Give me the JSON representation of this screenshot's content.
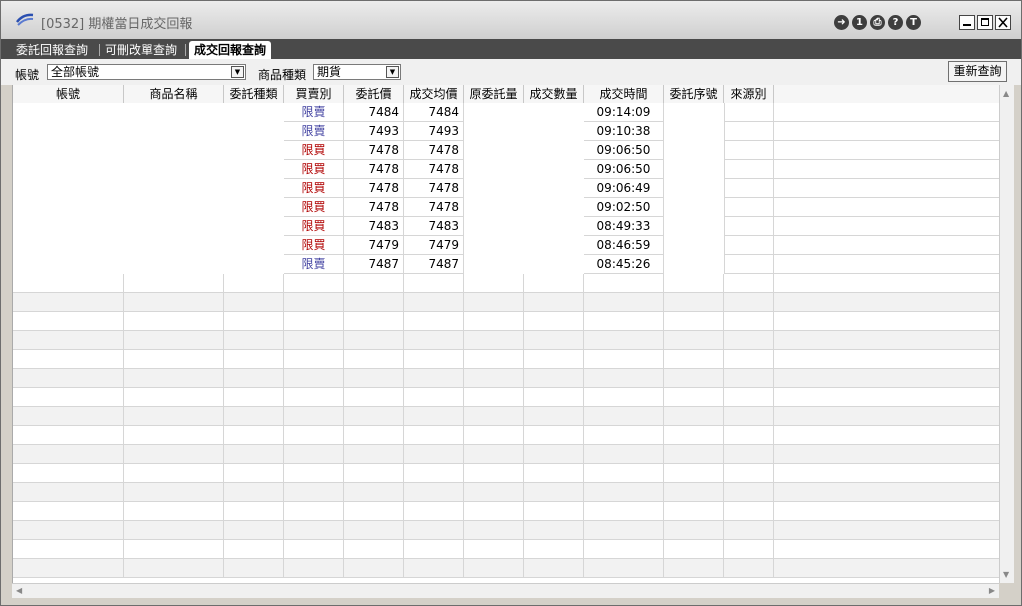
{
  "window": {
    "title": "[0532] 期權當日成交回報"
  },
  "title_icons": [
    {
      "name": "exit-icon",
      "glyph": "➜"
    },
    {
      "name": "number-one-icon",
      "glyph": "1"
    },
    {
      "name": "print-icon",
      "glyph": "⎙"
    },
    {
      "name": "help-icon",
      "glyph": "?"
    },
    {
      "name": "t-icon",
      "glyph": "T"
    }
  ],
  "tabs": [
    {
      "label": "委託回報查詢",
      "active": false
    },
    {
      "label": "可刪改單查詢",
      "active": false
    },
    {
      "label": "成交回報查詢",
      "active": true
    }
  ],
  "filters": {
    "account_label": "帳號",
    "account_value": "全部帳號",
    "product_label": "商品種類",
    "product_value": "期貨",
    "refresh_label": "重新查詢"
  },
  "table": {
    "columns": [
      "帳號",
      "商品名稱",
      "委託種類",
      "買賣別",
      "委託價",
      "成交均價",
      "原委託量",
      "成交數量",
      "成交時間",
      "委託序號",
      "來源別"
    ],
    "rows": [
      {
        "side": "限賣",
        "side_type": "sell",
        "price": "7484",
        "avg": "7484",
        "time": "09:14:09"
      },
      {
        "side": "限賣",
        "side_type": "sell",
        "price": "7493",
        "avg": "7493",
        "time": "09:10:38"
      },
      {
        "side": "限買",
        "side_type": "buy",
        "price": "7478",
        "avg": "7478",
        "time": "09:06:50"
      },
      {
        "side": "限買",
        "side_type": "buy",
        "price": "7478",
        "avg": "7478",
        "time": "09:06:50"
      },
      {
        "side": "限買",
        "side_type": "buy",
        "price": "7478",
        "avg": "7478",
        "time": "09:06:49"
      },
      {
        "side": "限買",
        "side_type": "buy",
        "price": "7478",
        "avg": "7478",
        "time": "09:02:50"
      },
      {
        "side": "限買",
        "side_type": "buy",
        "price": "7483",
        "avg": "7483",
        "time": "08:49:33"
      },
      {
        "side": "限買",
        "side_type": "buy",
        "price": "7479",
        "avg": "7479",
        "time": "08:46:59"
      },
      {
        "side": "限賣",
        "side_type": "sell",
        "price": "7487",
        "avg": "7487",
        "time": "08:45:26"
      }
    ]
  },
  "colors": {
    "buy": "#b00000",
    "sell": "#4040a0"
  }
}
